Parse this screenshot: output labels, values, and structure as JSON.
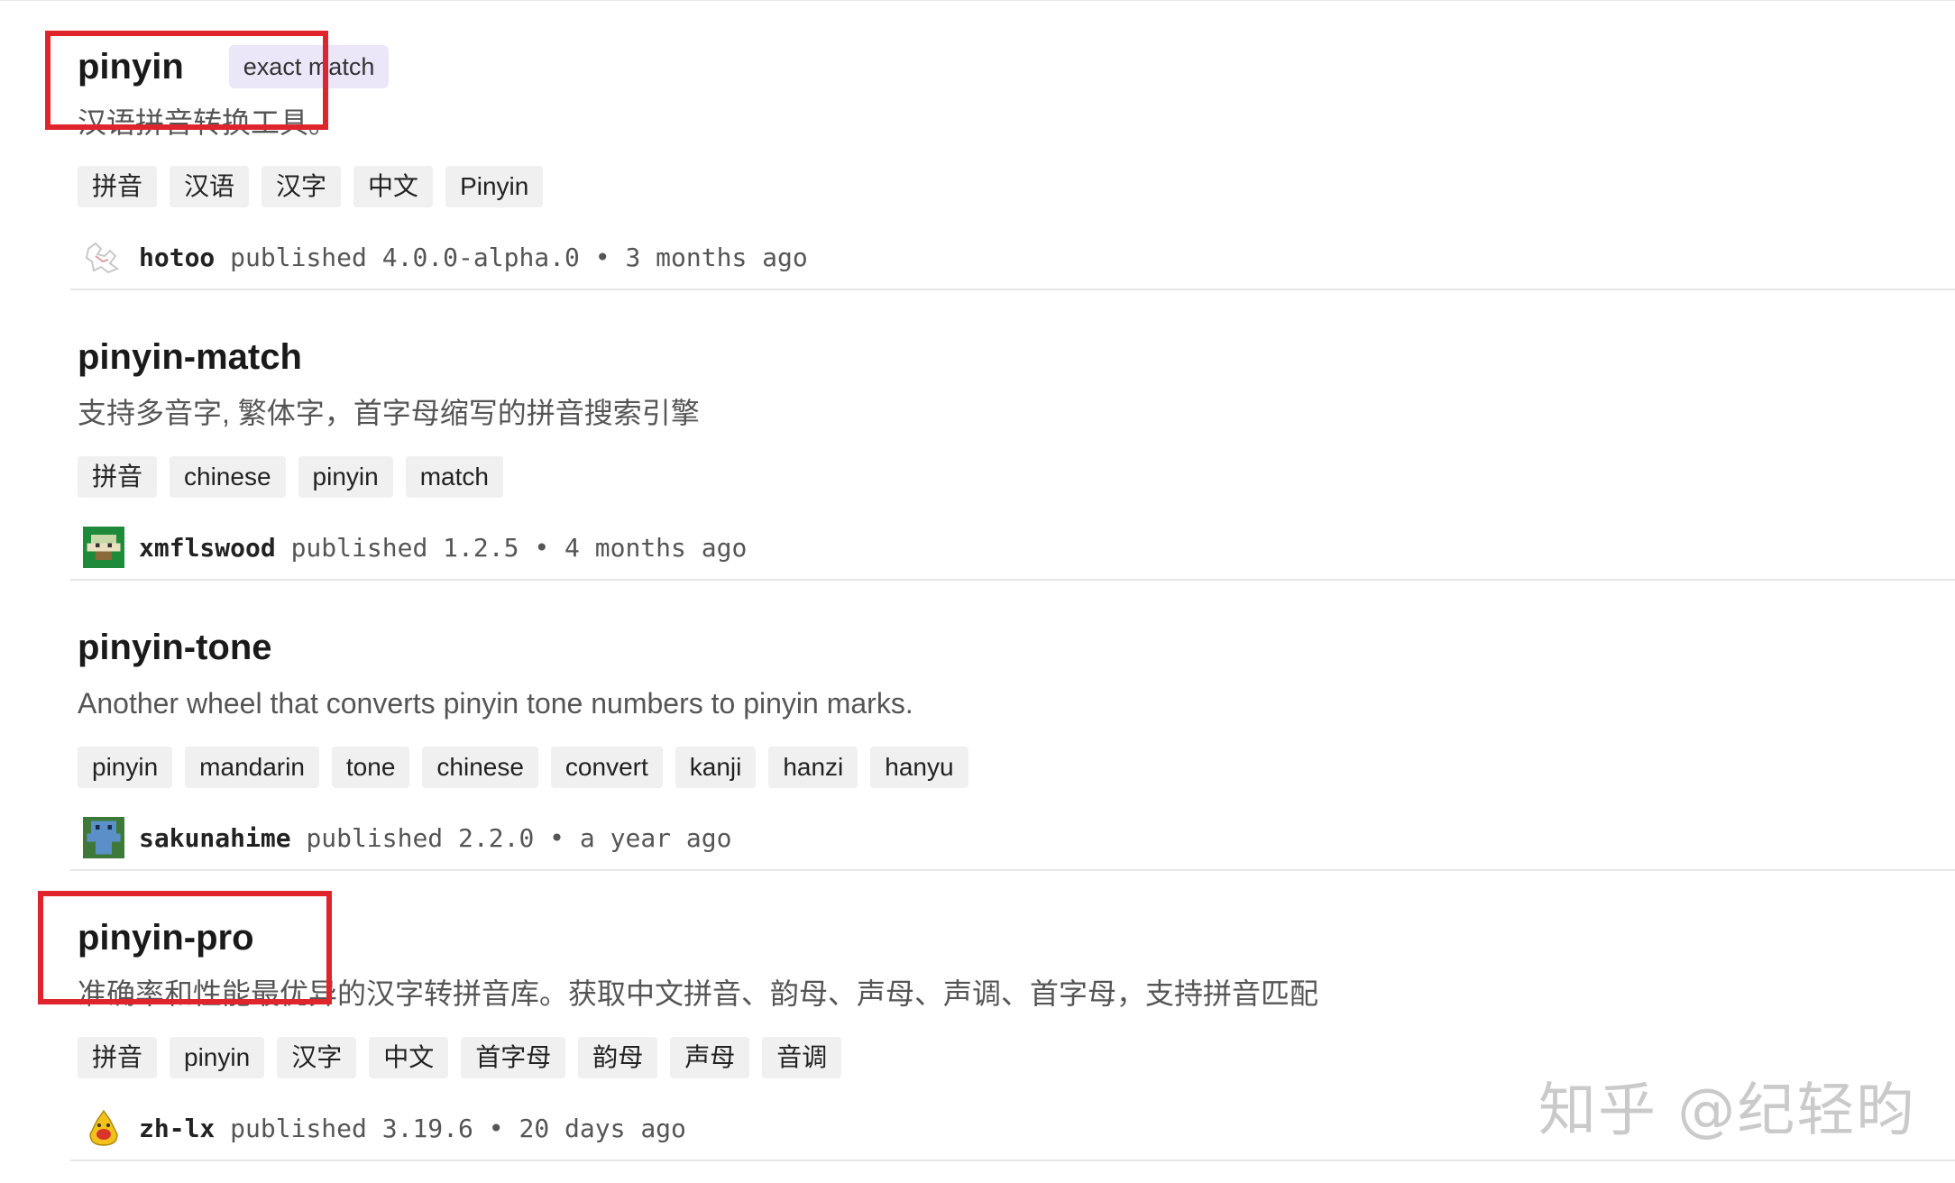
{
  "results": [
    {
      "name": "pinyin",
      "badge": "exact match",
      "description": "汉语拼音转换工具。",
      "keywords": [
        "拼音",
        "汉语",
        "汉字",
        "中文",
        "Pinyin"
      ],
      "publisher": "hotoo",
      "published_label": "published",
      "version": "4.0.0-alpha.0",
      "separator": "•",
      "time": "3 months ago",
      "avatar_icon": "sketch-avatar-icon"
    },
    {
      "name": "pinyin-match",
      "description": "支持多音字, 繁体字，首字母缩写的拼音搜索引擎",
      "keywords": [
        "拼音",
        "chinese",
        "pinyin",
        "match"
      ],
      "publisher": "xmflswood",
      "published_label": "published",
      "version": "1.2.5",
      "separator": "•",
      "time": "4 months ago",
      "avatar_icon": "green-pixel-avatar-icon"
    },
    {
      "name": "pinyin-tone",
      "description": "Another wheel that converts pinyin tone numbers to pinyin marks.",
      "keywords": [
        "pinyin",
        "mandarin",
        "tone",
        "chinese",
        "convert",
        "kanji",
        "hanzi",
        "hanyu"
      ],
      "publisher": "sakunahime",
      "published_label": "published",
      "version": "2.2.0",
      "separator": "•",
      "time": "a year ago",
      "avatar_icon": "blue-pixel-avatar-icon"
    },
    {
      "name": "pinyin-pro",
      "description": "准确率和性能最优异的汉字转拼音库。获取中文拼音、韵母、声母、声调、首字母，支持拼音匹配",
      "keywords": [
        "拼音",
        "pinyin",
        "汉字",
        "中文",
        "首字母",
        "韵母",
        "声母",
        "音调"
      ],
      "publisher": "zh-lx",
      "published_label": "published",
      "version": "3.19.6",
      "separator": "•",
      "time": "20 days ago",
      "avatar_icon": "yellow-cartoon-avatar-icon"
    }
  ],
  "watermark": "知乎 @纪轻昀",
  "colors": {
    "highlight_box": "#e0242c",
    "badge_bg": "#ece6f9",
    "tag_bg": "#f0f0f0"
  }
}
